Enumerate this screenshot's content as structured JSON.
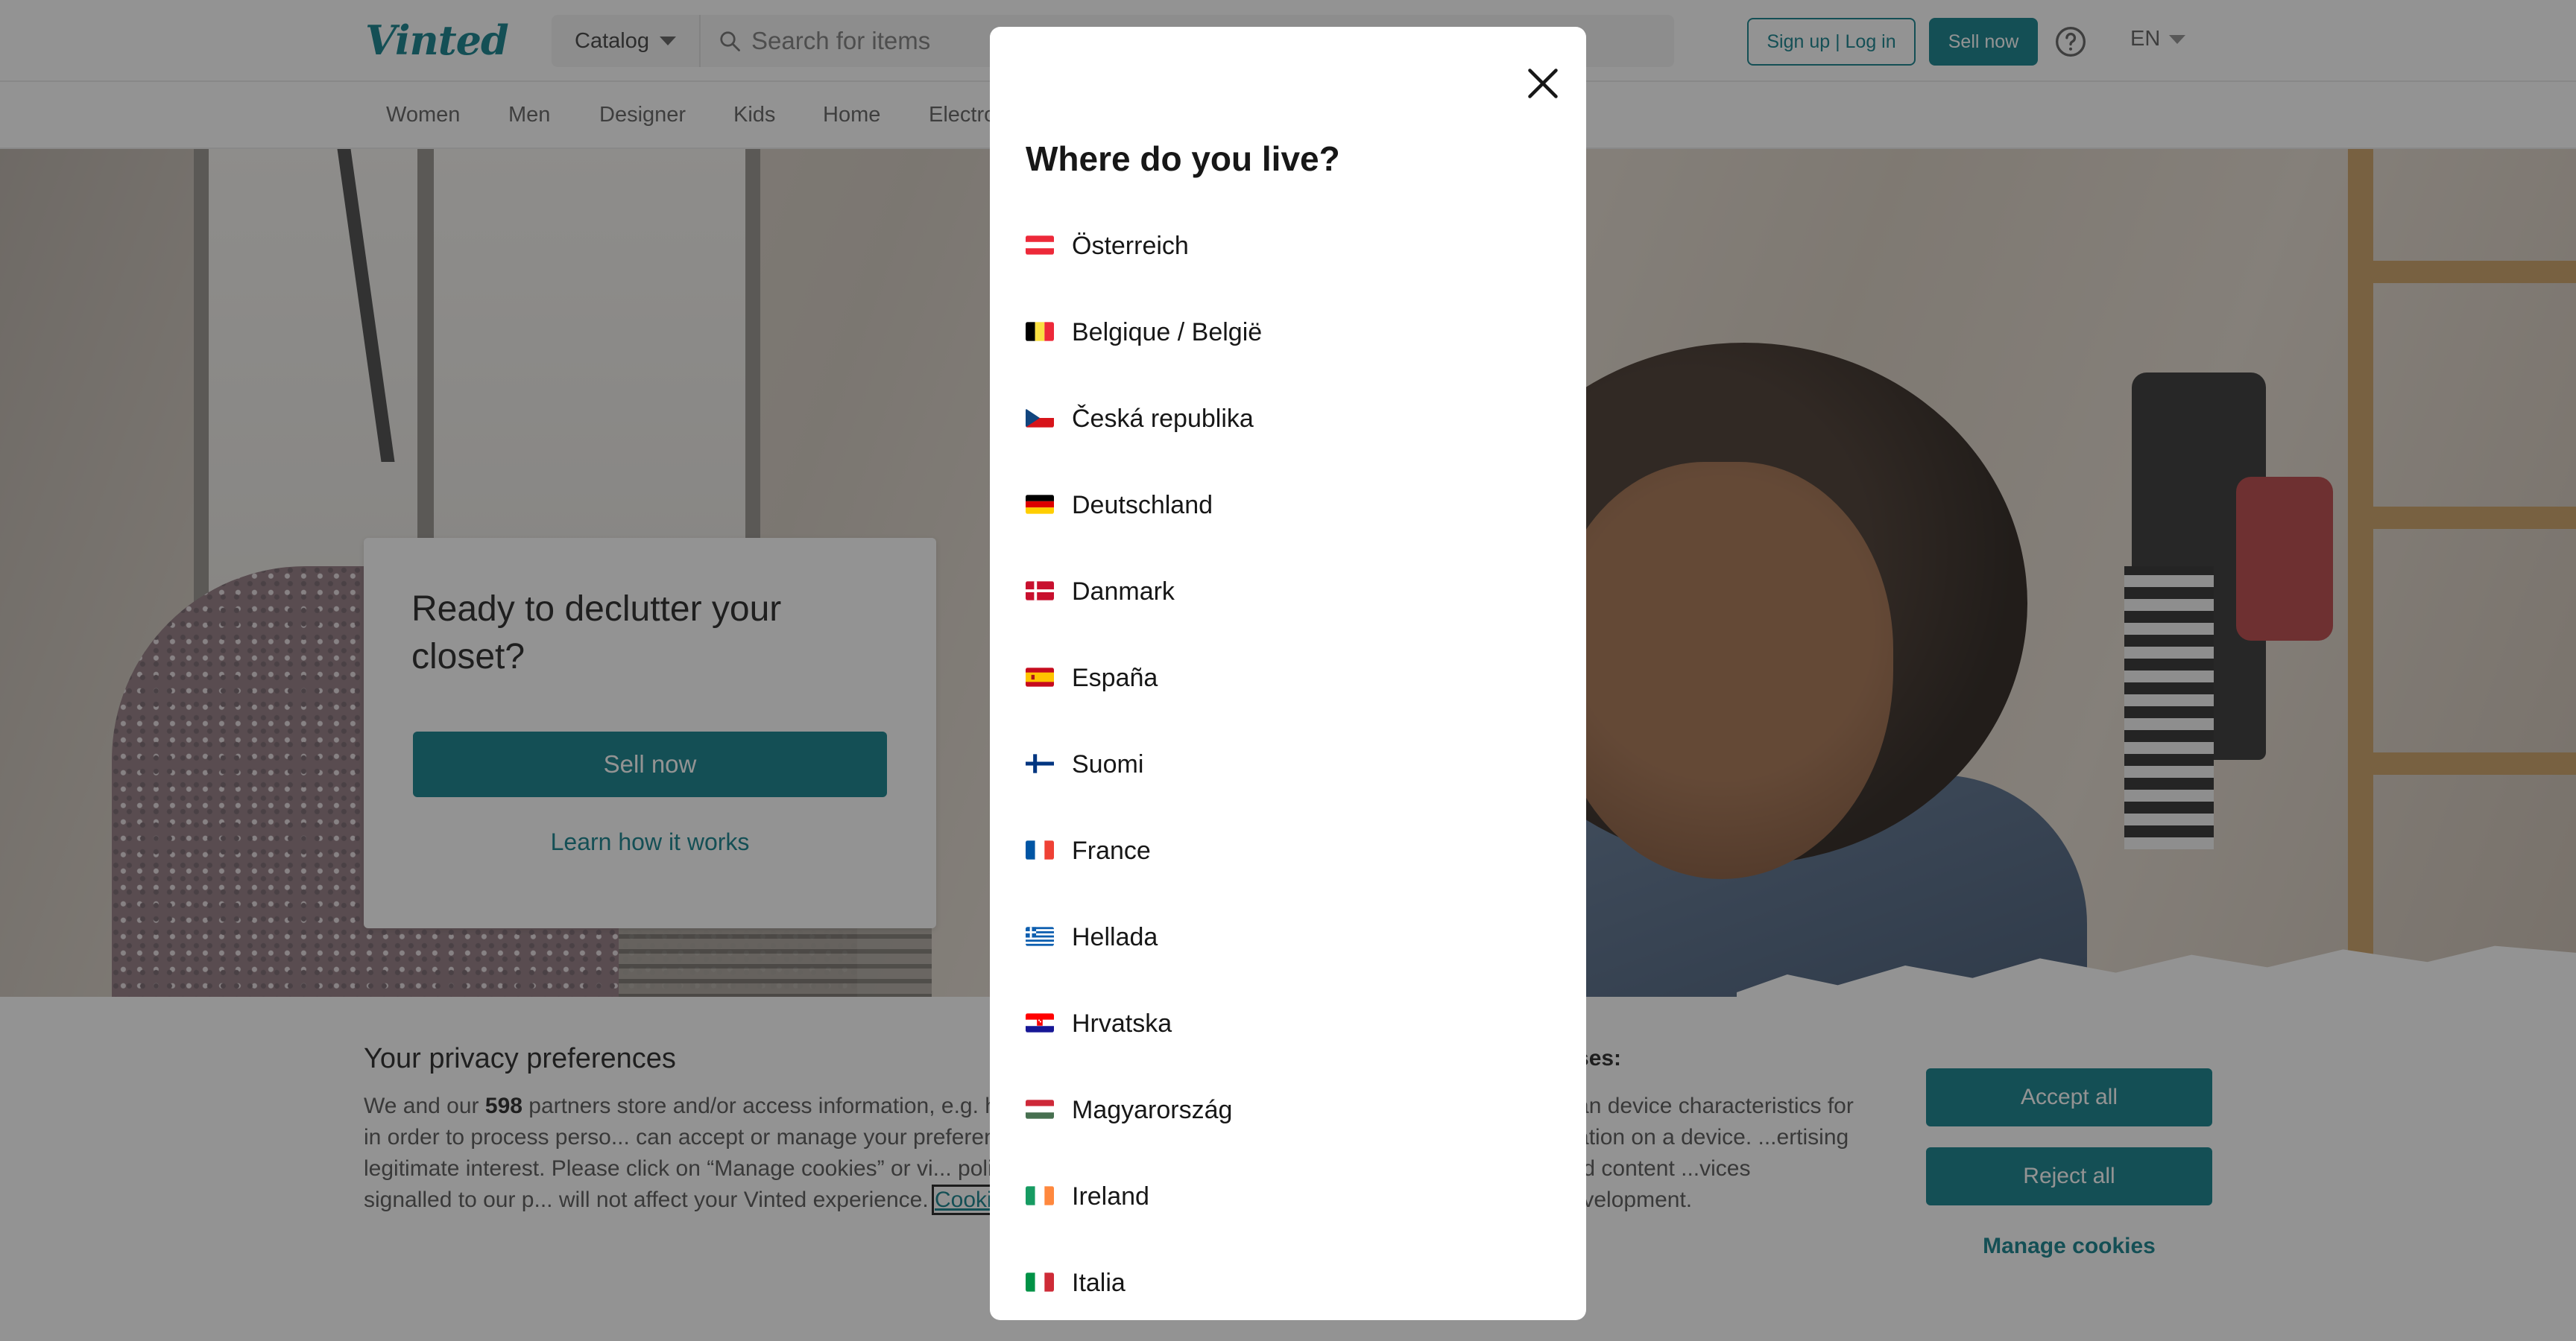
{
  "header": {
    "logo": "Vinted",
    "catalog_label": "Catalog",
    "search_placeholder": "Search for items",
    "login_label": "Sign up | Log in",
    "sell_label": "Sell now",
    "language": "EN"
  },
  "subnav": [
    "Women",
    "Men",
    "Designer",
    "Kids",
    "Home",
    "Electronics"
  ],
  "hero": {
    "title": "Ready to declutter your closet?",
    "sell_button": "Sell now",
    "learn_link": "Learn how it works"
  },
  "privacy": {
    "title": "Your privacy preferences",
    "text_before_count": "We and our ",
    "partner_count": "598",
    "text_after_count": " partners store and/or access information, e.g. ha... addresses, unique identifiers in cookies, in order to process perso... can accept or manage your preferences, including your right to o... have a legitimate interest. Please click on “Manage cookies” or vi... policy page at any time. These preferences are signalled to our p... will not affect your Vinted experience. ",
    "cookie_link": "Cookie policy",
    "purposes_title": "...ses:",
    "purposes_text": "...an device characteristics for ...ation on a device. ...ertising and content ...vices development.",
    "accept_label": "Accept all",
    "reject_label": "Reject all",
    "manage_label": "Manage cookies"
  },
  "modal": {
    "title": "Where do you live?",
    "countries": [
      {
        "name": "Österreich",
        "flag": "flag-at-icon"
      },
      {
        "name": "Belgique / België",
        "flag": "flag-be-icon"
      },
      {
        "name": "Česká republika",
        "flag": "flag-cz-icon"
      },
      {
        "name": "Deutschland",
        "flag": "flag-de-icon"
      },
      {
        "name": "Danmark",
        "flag": "flag-dk-icon"
      },
      {
        "name": "España",
        "flag": "flag-es-icon"
      },
      {
        "name": "Suomi",
        "flag": "flag-fi-icon"
      },
      {
        "name": "France",
        "flag": "flag-fr-icon"
      },
      {
        "name": "Hellada",
        "flag": "flag-gr-icon"
      },
      {
        "name": "Hrvatska",
        "flag": "flag-hr-icon"
      },
      {
        "name": "Magyarország",
        "flag": "flag-hu-icon"
      },
      {
        "name": "Ireland",
        "flag": "flag-ie-icon"
      },
      {
        "name": "Italia",
        "flag": "flag-it-icon"
      }
    ]
  },
  "colors": {
    "brand": "#007782",
    "overlay": "rgba(40,40,40,0.5)"
  },
  "icons": {
    "search": "search-icon",
    "help": "help-icon",
    "close": "close-icon",
    "caret": "chevron-down-icon"
  }
}
